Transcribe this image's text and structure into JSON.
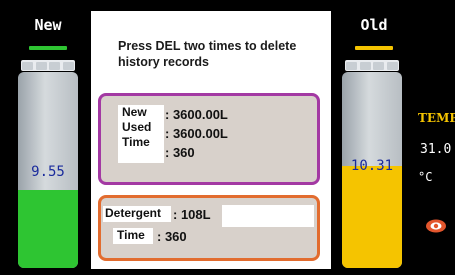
{
  "left_tank": {
    "title": "New",
    "value": "9.55",
    "fill_fraction": 0.4,
    "marker_color": "#2ec532",
    "fill_color": "#2ec532",
    "value_color": "#1a2b9c"
  },
  "right_tank": {
    "title": "Old",
    "value": "10.31",
    "fill_fraction": 0.52,
    "marker_color": "#f5c400",
    "fill_color": "#f5c400",
    "value_color": "#1a2b9c"
  },
  "panel": {
    "instruction": "Press DEL two times to delete history records",
    "history": {
      "new_label": "New",
      "new_value": ": 3600.00L",
      "used_label": "Used",
      "used_value": ": 3600.00L",
      "time_label": "Time",
      "time_value": ": 360"
    },
    "detergent": {
      "detergent_label": "Detergent",
      "detergent_value": ": 108L",
      "time_label": "Time",
      "time_value": ": 360"
    }
  },
  "side": {
    "temp_label": "TEMP",
    "temp_value": "31.0",
    "temp_unit": "°C",
    "lamp_icon": "warning-lamp-icon",
    "colors": {
      "accent_purple": "#a339a3",
      "accent_orange": "#e26c2f",
      "temp_yellow": "#f5c400"
    }
  }
}
